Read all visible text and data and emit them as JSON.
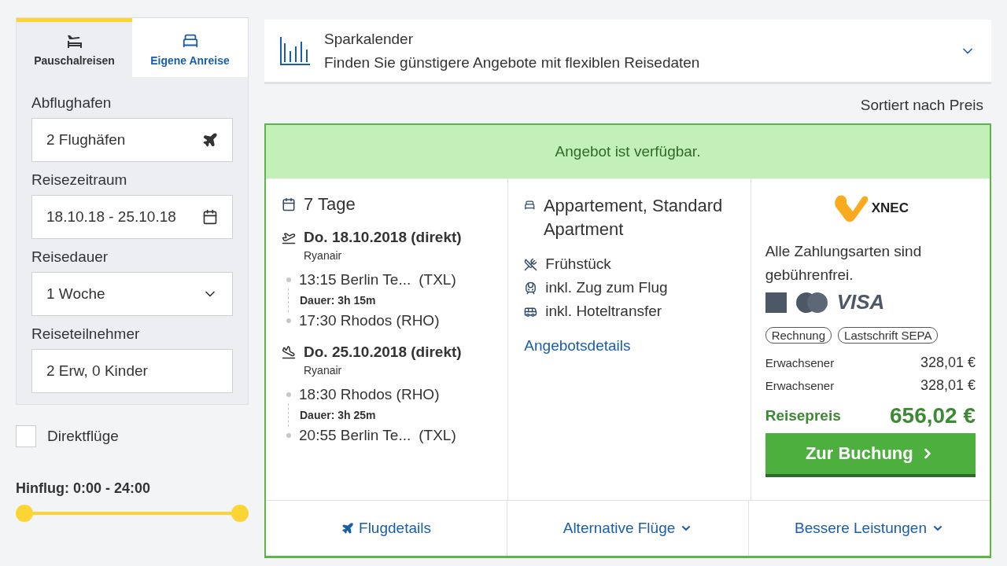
{
  "sidebar": {
    "tabs": [
      {
        "label": "Pauschalreisen",
        "selected": true,
        "kind": "package"
      },
      {
        "label": "Eigene Anreise",
        "selected": false,
        "kind": "hotel"
      }
    ],
    "fields": [
      {
        "label": "Abflughafen",
        "value": "2 Flughäfen",
        "kind": "airport"
      },
      {
        "label": "Reisezeitraum",
        "value": "18.10.18 - 25.10.18",
        "kind": "date"
      },
      {
        "label": "Reisedauer",
        "value": "1 Woche",
        "kind": "select"
      },
      {
        "label": "Reiseteilnehmer",
        "value": "2 Erw, 0 Kinder",
        "kind": "text"
      }
    ],
    "direct_flights": {
      "label": "Direktflüge",
      "checked": false
    },
    "departure_time": {
      "label": "Hinflug: 0:00 - 24:00",
      "handles": [
        {
          "level": 0
        },
        {
          "level": 1
        }
      ]
    }
  },
  "savings_calendar": {
    "title": "Sparkalender",
    "subtitle": "Finden Sie günstigere Angebote mit flexiblen Reisedaten",
    "expanded": false
  },
  "sort_label": "Sortiert nach Preis",
  "offer": {
    "status": "Angebot ist verfügbar.",
    "duration": "7 Tage",
    "flights": [
      {
        "kind": "outbound",
        "date": "Do. 18.10.2018 (direkt)",
        "airline": "Ryanair",
        "departure": "13:15 Berlin Te...",
        "departure_code": "(TXL)",
        "flight_time": "Dauer: 3h 15m",
        "arrival": "17:30 Rhodos (RHO)"
      },
      {
        "kind": "return",
        "date": "Do. 25.10.2018 (direkt)",
        "airline": "Ryanair",
        "departure": "18:30 Rhodos (RHO)",
        "flight_time": "Dauer: 3h 25m",
        "arrival": "20:55 Berlin Te...",
        "arrival_code": "(TXL)"
      }
    ],
    "room": "Appartement, Standard Apartment",
    "amenities": [
      {
        "kind": "meal",
        "label": "Frühstück"
      },
      {
        "kind": "train",
        "label": "inkl. Zug zum Flug"
      },
      {
        "kind": "bus",
        "label": "inkl. Hoteltransfer"
      }
    ],
    "details_link": "Angebotsdetails",
    "operator": {
      "logo_text": "XNEC",
      "payment_note": "Alle Zahlungsarten sind gebührenfrei.",
      "cards": [
        {
          "kind": "amex"
        },
        {
          "kind": "mastercard"
        },
        {
          "kind": "visa",
          "label": "VISA"
        }
      ],
      "methods": [
        "Rechnung",
        "Lastschrift SEPA"
      ],
      "prices": [
        {
          "label": "Erwachsener",
          "amount": "328,01 €"
        },
        {
          "label": "Erwachsener",
          "amount": "328,01 €"
        }
      ],
      "total_label": "Reisepreis",
      "total": "656,02 €",
      "book_button": "Zur Buchung"
    },
    "footer": [
      {
        "kind": "flight",
        "label": "Flugdetails"
      },
      {
        "kind": "dropdown",
        "label": "Alternative Flüge"
      },
      {
        "kind": "dropdown",
        "label": "Bessere Leistungen"
      }
    ]
  }
}
